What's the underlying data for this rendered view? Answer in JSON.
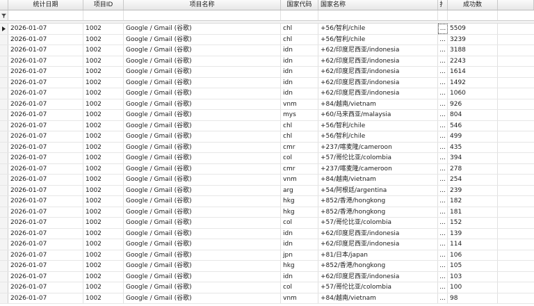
{
  "columns": [
    "统计日期",
    "项目ID",
    "项目名称",
    "国家代码",
    "国家名称",
    "扌",
    "成功数"
  ],
  "filter_icon": "filter-funnel-icon",
  "current_row_icon": "current-row-arrow-icon",
  "row_ellipsis": "...",
  "rows": [
    {
      "date": "2026-01-07",
      "pid": "1002",
      "pname": "Google / Gmail (谷歌)",
      "code": "chl",
      "cname": "+56/智利/chile",
      "count": "5509"
    },
    {
      "date": "2026-01-07",
      "pid": "1002",
      "pname": "Google / Gmail (谷歌)",
      "code": "chl",
      "cname": "+56/智利/chile",
      "count": "3239"
    },
    {
      "date": "2026-01-07",
      "pid": "1002",
      "pname": "Google / Gmail (谷歌)",
      "code": "idn",
      "cname": "+62/印度尼西亚/indonesia",
      "count": "3188"
    },
    {
      "date": "2026-01-07",
      "pid": "1002",
      "pname": "Google / Gmail (谷歌)",
      "code": "idn",
      "cname": "+62/印度尼西亚/indonesia",
      "count": "2243"
    },
    {
      "date": "2026-01-07",
      "pid": "1002",
      "pname": "Google / Gmail (谷歌)",
      "code": "idn",
      "cname": "+62/印度尼西亚/indonesia",
      "count": "1614"
    },
    {
      "date": "2026-01-07",
      "pid": "1002",
      "pname": "Google / Gmail (谷歌)",
      "code": "idn",
      "cname": "+62/印度尼西亚/indonesia",
      "count": "1492"
    },
    {
      "date": "2026-01-07",
      "pid": "1002",
      "pname": "Google / Gmail (谷歌)",
      "code": "idn",
      "cname": "+62/印度尼西亚/indonesia",
      "count": "1060"
    },
    {
      "date": "2026-01-07",
      "pid": "1002",
      "pname": "Google / Gmail (谷歌)",
      "code": "vnm",
      "cname": "+84/越南/vietnam",
      "count": "926"
    },
    {
      "date": "2026-01-07",
      "pid": "1002",
      "pname": "Google / Gmail (谷歌)",
      "code": "mys",
      "cname": "+60/马来西亚/malaysia",
      "count": "804"
    },
    {
      "date": "2026-01-07",
      "pid": "1002",
      "pname": "Google / Gmail (谷歌)",
      "code": "chl",
      "cname": "+56/智利/chile",
      "count": "546"
    },
    {
      "date": "2026-01-07",
      "pid": "1002",
      "pname": "Google / Gmail (谷歌)",
      "code": "chl",
      "cname": "+56/智利/chile",
      "count": "499"
    },
    {
      "date": "2026-01-07",
      "pid": "1002",
      "pname": "Google / Gmail (谷歌)",
      "code": "cmr",
      "cname": "+237/喀麦隆/cameroon",
      "count": "435"
    },
    {
      "date": "2026-01-07",
      "pid": "1002",
      "pname": "Google / Gmail (谷歌)",
      "code": "col",
      "cname": "+57/哥伦比亚/colombia",
      "count": "394"
    },
    {
      "date": "2026-01-07",
      "pid": "1002",
      "pname": "Google / Gmail (谷歌)",
      "code": "cmr",
      "cname": "+237/喀麦隆/cameroon",
      "count": "278"
    },
    {
      "date": "2026-01-07",
      "pid": "1002",
      "pname": "Google / Gmail (谷歌)",
      "code": "vnm",
      "cname": "+84/越南/vietnam",
      "count": "254"
    },
    {
      "date": "2026-01-07",
      "pid": "1002",
      "pname": "Google / Gmail (谷歌)",
      "code": "arg",
      "cname": "+54/阿根廷/argentina",
      "count": "239"
    },
    {
      "date": "2026-01-07",
      "pid": "1002",
      "pname": "Google / Gmail (谷歌)",
      "code": "hkg",
      "cname": "+852/香港/hongkong",
      "count": "182"
    },
    {
      "date": "2026-01-07",
      "pid": "1002",
      "pname": "Google / Gmail (谷歌)",
      "code": "hkg",
      "cname": "+852/香港/hongkong",
      "count": "181"
    },
    {
      "date": "2026-01-07",
      "pid": "1002",
      "pname": "Google / Gmail (谷歌)",
      "code": "col",
      "cname": "+57/哥伦比亚/colombia",
      "count": "152"
    },
    {
      "date": "2026-01-07",
      "pid": "1002",
      "pname": "Google / Gmail (谷歌)",
      "code": "idn",
      "cname": "+62/印度尼西亚/indonesia",
      "count": "139"
    },
    {
      "date": "2026-01-07",
      "pid": "1002",
      "pname": "Google / Gmail (谷歌)",
      "code": "idn",
      "cname": "+62/印度尼西亚/indonesia",
      "count": "114"
    },
    {
      "date": "2026-01-07",
      "pid": "1002",
      "pname": "Google / Gmail (谷歌)",
      "code": "jpn",
      "cname": "+81/日本/japan",
      "count": "106"
    },
    {
      "date": "2026-01-07",
      "pid": "1002",
      "pname": "Google / Gmail (谷歌)",
      "code": "hkg",
      "cname": "+852/香港/hongkong",
      "count": "105"
    },
    {
      "date": "2026-01-07",
      "pid": "1002",
      "pname": "Google / Gmail (谷歌)",
      "code": "idn",
      "cname": "+62/印度尼西亚/indonesia",
      "count": "103"
    },
    {
      "date": "2026-01-07",
      "pid": "1002",
      "pname": "Google / Gmail (谷歌)",
      "code": "col",
      "cname": "+57/哥伦比亚/colombia",
      "count": "100"
    },
    {
      "date": "2026-01-07",
      "pid": "1002",
      "pname": "Google / Gmail (谷歌)",
      "code": "vnm",
      "cname": "+84/越南/vietnam",
      "count": "98"
    }
  ]
}
